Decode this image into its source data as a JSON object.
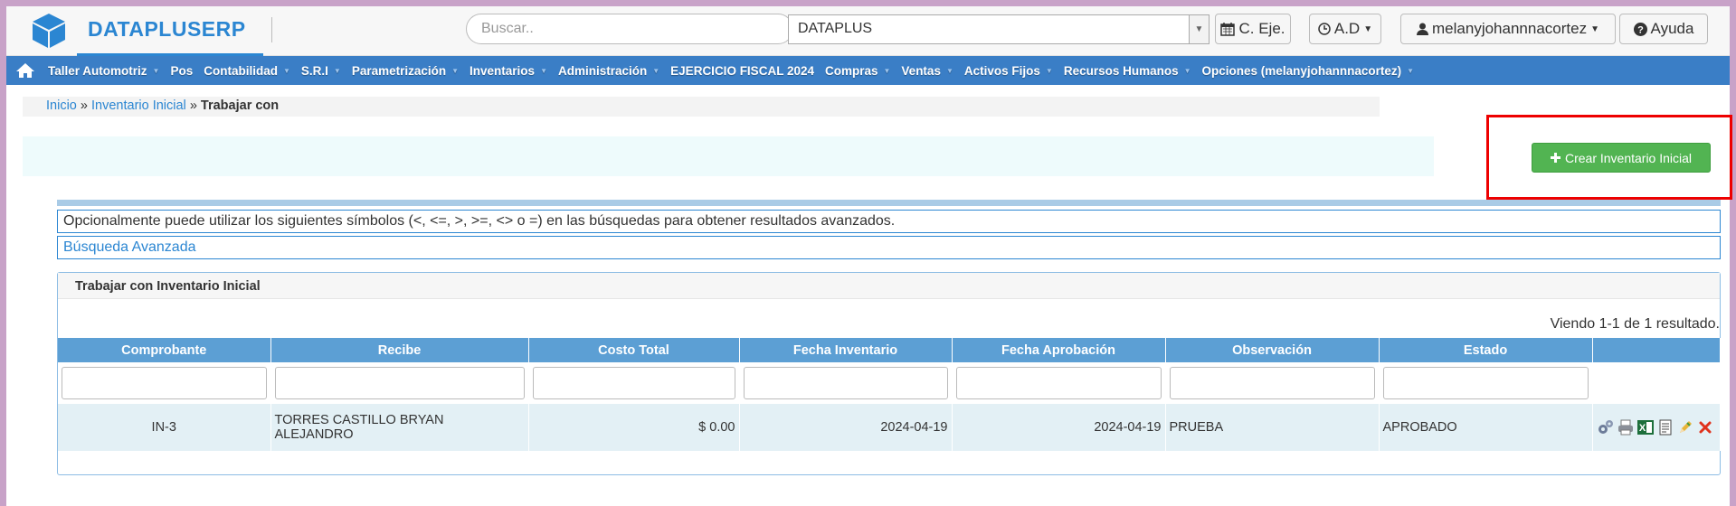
{
  "brand": {
    "name": "DATAPLUSERP"
  },
  "search": {
    "placeholder": "Buscar.."
  },
  "company": {
    "selected": "DATAPLUS"
  },
  "toolbar": {
    "ejercicio": "C. Eje.",
    "ad": "A.D",
    "user": "melanyjohannnacortez",
    "help": "Ayuda"
  },
  "nav": {
    "items": [
      {
        "label": "Taller Automotriz",
        "has_menu": true
      },
      {
        "label": "Pos",
        "has_menu": false
      },
      {
        "label": "Contabilidad",
        "has_menu": true
      },
      {
        "label": "S.R.I",
        "has_menu": true
      },
      {
        "label": "Parametrización",
        "has_menu": true
      },
      {
        "label": "Inventarios",
        "has_menu": true
      },
      {
        "label": "Administración",
        "has_menu": true
      },
      {
        "label": "EJERCICIO FISCAL 2024",
        "has_menu": false
      },
      {
        "label": "Compras",
        "has_menu": true
      },
      {
        "label": "Ventas",
        "has_menu": true
      },
      {
        "label": "Activos Fijos",
        "has_menu": true
      },
      {
        "label": "Recursos Humanos",
        "has_menu": true
      },
      {
        "label": "Opciones (melanyjohannnacortez)",
        "has_menu": true
      }
    ]
  },
  "breadcrumb": {
    "home": "Inicio",
    "section": "Inventario Inicial",
    "current": "Trabajar con",
    "sep": "»"
  },
  "actions": {
    "create_label": "Crear Inventario Inicial"
  },
  "info": {
    "hint": "Opcionalmente puede utilizar los siguientes símbolos (<, <=, >, >=, <> o =) en las búsquedas para obtener resultados avanzados.",
    "advanced_search": "Búsqueda Avanzada"
  },
  "panel": {
    "title": "Trabajar con Inventario Inicial",
    "summary": "Viendo 1-1 de 1 resultado."
  },
  "table": {
    "columns": [
      "Comprobante",
      "Recibe",
      "Costo Total",
      "Fecha Inventario",
      "Fecha Aprobación",
      "Observación",
      "Estado"
    ],
    "rows": [
      {
        "comprobante": "IN-3",
        "recibe": "TORRES CASTILLO BRYAN ALEJANDRO",
        "costo_total": "$ 0.00",
        "fecha_inventario": "2024-04-19",
        "fecha_aprobacion": "2024-04-19",
        "observacion": "PRUEBA",
        "estado": "APROBADO"
      }
    ],
    "row_action_icons": [
      "gears-icon",
      "print-icon",
      "excel-icon",
      "document-icon",
      "edit-icon",
      "delete-icon"
    ]
  },
  "colors": {
    "brand": "#2b86d2",
    "navbar": "#3a7ec6",
    "create_button": "#52b452",
    "table_header": "#5c9fd4",
    "highlight": "#ee0000"
  }
}
